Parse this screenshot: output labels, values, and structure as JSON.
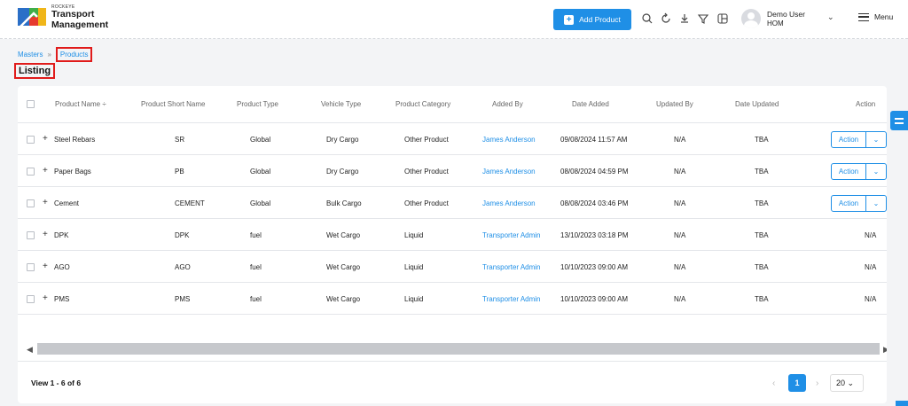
{
  "header": {
    "logo_small": "ROCKEYE",
    "logo_line1": "Transport",
    "logo_line2": "Management",
    "add_product_label": "Add Product",
    "user_name": "Demo User",
    "user_role": "HOM",
    "menu_label": "Menu"
  },
  "breadcrumb": {
    "parent": "Masters",
    "separator": "»",
    "current": "Products"
  },
  "page_title": "Listing",
  "table": {
    "columns": [
      "Product Name",
      "Product Short Name",
      "Product Type",
      "Vehicle Type",
      "Product Category",
      "Added By",
      "Date Added",
      "Updated By",
      "Date Updated",
      "Action"
    ],
    "sort_indicator": "÷",
    "action_label": "Action",
    "rows": [
      {
        "name": "Steel Rebars",
        "short": "SR",
        "type": "Global",
        "vehicle": "Dry Cargo",
        "category": "Other Product",
        "added_by": "James Anderson",
        "date_added": "09/08/2024 11:57 AM",
        "updated_by": "N/A",
        "date_updated": "TBA",
        "action": "button"
      },
      {
        "name": "Paper Bags",
        "short": "PB",
        "type": "Global",
        "vehicle": "Dry Cargo",
        "category": "Other Product",
        "added_by": "James Anderson",
        "date_added": "08/08/2024 04:59 PM",
        "updated_by": "N/A",
        "date_updated": "TBA",
        "action": "button"
      },
      {
        "name": "Cement",
        "short": "CEMENT",
        "type": "Global",
        "vehicle": "Bulk Cargo",
        "category": "Other Product",
        "added_by": "James Anderson",
        "date_added": "08/08/2024 03:46 PM",
        "updated_by": "N/A",
        "date_updated": "TBA",
        "action": "button"
      },
      {
        "name": "DPK",
        "short": "DPK",
        "type": "fuel",
        "vehicle": "Wet Cargo",
        "category": "Liquid",
        "added_by": "Transporter Admin",
        "date_added": "13/10/2023 03:18 PM",
        "updated_by": "N/A",
        "date_updated": "TBA",
        "action": "N/A"
      },
      {
        "name": "AGO",
        "short": "AGO",
        "type": "fuel",
        "vehicle": "Wet Cargo",
        "category": "Liquid",
        "added_by": "Transporter Admin",
        "date_added": "10/10/2023 09:00 AM",
        "updated_by": "N/A",
        "date_updated": "TBA",
        "action": "N/A"
      },
      {
        "name": "PMS",
        "short": "PMS",
        "type": "fuel",
        "vehicle": "Wet Cargo",
        "category": "Liquid",
        "added_by": "Transporter Admin",
        "date_added": "10/10/2023 09:00 AM",
        "updated_by": "N/A",
        "date_updated": "TBA",
        "action": "N/A"
      }
    ]
  },
  "footer": {
    "view_text": "View 1 - 6 of 6",
    "current_page": "1",
    "page_size": "20"
  },
  "icons": {
    "search": "search-icon",
    "refresh": "refresh-icon",
    "download": "download-icon",
    "filter": "filter-icon",
    "layout": "layout-icon",
    "settings_tab": "sliders-icon"
  },
  "colors": {
    "accent": "#1f8fe6",
    "highlight_box": "#e01b1b"
  }
}
